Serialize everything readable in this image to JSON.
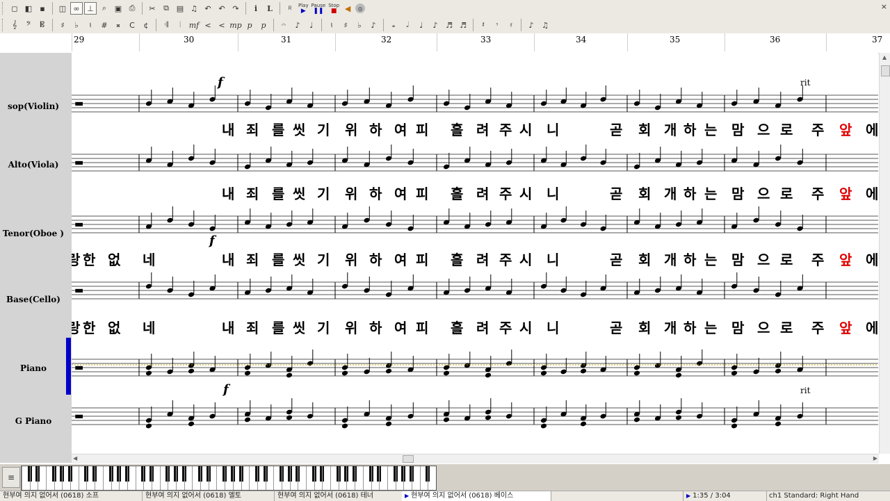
{
  "toolbar": {
    "play_label": "Play",
    "pause_label": "Pause",
    "stop_label": "Stop",
    "close_icon": "×",
    "row1_glyphs": [
      "◻",
      "◧",
      "▪",
      "◫",
      "∞",
      "⊥",
      "⌕",
      "▣",
      "⎙",
      "✂",
      "⧉",
      "▤",
      "♫",
      "↶",
      "↶",
      "↷",
      "i",
      "L",
      "Ｒ"
    ],
    "row2_glyphs": [
      "𝄞",
      "𝄢",
      "𝄡",
      "♯",
      "♭",
      "♮",
      "#",
      "𝄪",
      "C",
      "¢",
      "𝄇",
      "𝄀",
      "mf",
      "<",
      "<",
      "mp",
      "p",
      "p",
      "𝄐",
      "♪",
      "♩",
      "♮",
      "♯",
      "♭",
      "♪",
      "𝅝",
      "𝅗𝅥",
      "♩",
      "♪",
      "♬",
      "♬",
      "𝄽",
      "𝄾",
      "𝄿",
      "♪",
      "♫"
    ]
  },
  "ruler": {
    "measure_numbers": [
      "29",
      "30",
      "31",
      "32",
      "33",
      "34",
      "35",
      "36",
      "37"
    ]
  },
  "tracks": [
    {
      "name": "sop(Violin)",
      "color": "#000000"
    },
    {
      "name": "Alto(Viola)",
      "color": "#000000"
    },
    {
      "name": "Tenor(Oboe )",
      "color": "#000000"
    },
    {
      "name": "Base(Cello)",
      "color": "#000000"
    },
    {
      "name": "Piano",
      "color": "#000000"
    },
    {
      "name": "G Piano",
      "color": "#000000"
    }
  ],
  "score": {
    "dynamics": [
      "f",
      "f",
      "f"
    ],
    "lyrics_main": [
      "내",
      "죄",
      "를",
      "씻",
      "기",
      "위",
      "하",
      "여",
      "피",
      "흘",
      "려",
      "주",
      "시",
      "니",
      "곧",
      "회",
      "개",
      "하",
      "는",
      "맘",
      "으",
      "로",
      "주",
      "앞",
      "에"
    ],
    "lyrics_tenor_pickup": [
      "랑",
      "한",
      "없",
      "네"
    ],
    "lyric_highlight": "앞",
    "highlight_color": "#e00000",
    "expressions": {
      "rit_top": "rit",
      "rit_piano": "rit"
    }
  },
  "statusbar": {
    "tabs": [
      "현부여 의지 없어서 (0618) 소프",
      "현부여 의지 없어서 (0618) 엘토",
      "현부여 의지 없어서 (0618) 테너",
      "현부여 의지 없어서 (0618) 베이스"
    ],
    "active_tab_index": 3,
    "time": "1:35 / 3:04",
    "channel": "ch1 Standard: Right Hand"
  }
}
